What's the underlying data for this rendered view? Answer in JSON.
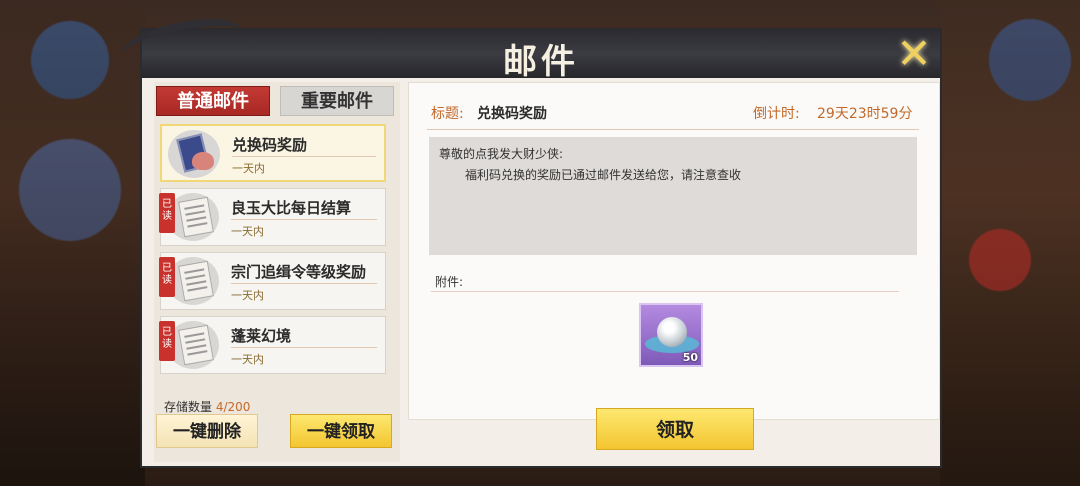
{
  "window": {
    "title": "邮件",
    "close_icon": "close-icon"
  },
  "tabs": {
    "normal": "普通邮件",
    "important": "重要邮件"
  },
  "mail_list": [
    {
      "title": "兑换码奖励",
      "sub": "一天内",
      "read": false,
      "selected": true,
      "icon": "book-pouch-icon"
    },
    {
      "title": "良玉大比每日结算",
      "sub": "一天内",
      "read": true,
      "selected": false,
      "icon": "letter-icon"
    },
    {
      "title": "宗门追缉令等级奖励",
      "sub": "一天内",
      "read": true,
      "selected": false,
      "icon": "letter-icon"
    },
    {
      "title": "蓬莱幻境",
      "sub": "一天内",
      "read": true,
      "selected": false,
      "icon": "letter-icon"
    }
  ],
  "read_stamp": "已读",
  "storage": {
    "label": "存储数量",
    "count": "4/200"
  },
  "buttons": {
    "delete_all": "一键删除",
    "claim_all": "一键领取",
    "claim": "领取"
  },
  "detail": {
    "subject_label": "标题:",
    "subject": "兑换码奖励",
    "countdown_label": "倒计时:",
    "countdown": "29天23时59分",
    "greeting": "尊敬的点我发大财少侠:",
    "body": "福利码兑换的奖励已通过邮件发送给您，请注意查收",
    "attachments_label": "附件:",
    "attachment": {
      "icon": "pearl-icon",
      "quantity": "50"
    }
  }
}
